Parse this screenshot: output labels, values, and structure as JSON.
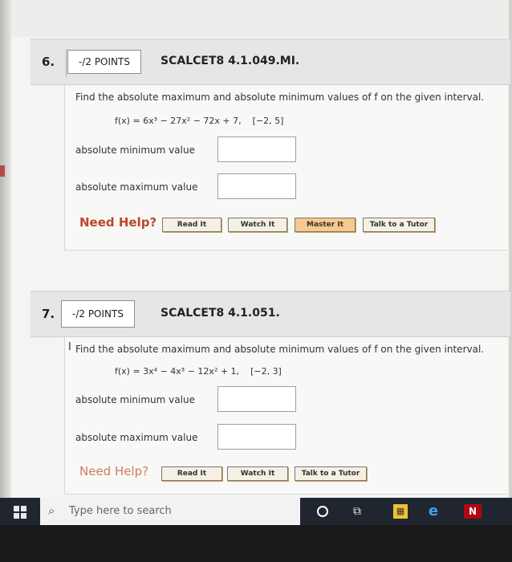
{
  "questions": [
    {
      "number": "6.",
      "points": "-/2 POINTS",
      "code": "SCALCET8 4.1.049.MI.",
      "prompt": "Find the absolute maximum and absolute minimum values of f on the given interval.",
      "function": "f(x) = 6x³ − 27x² − 72x + 7,",
      "interval": "[−2, 5]",
      "min_label": "absolute minimum value",
      "max_label": "absolute maximum value",
      "min_value": "",
      "max_value": "",
      "need_help": "Need Help?",
      "help_buttons": [
        "Read It",
        "Watch It",
        "Master It",
        "Talk to a Tutor"
      ]
    },
    {
      "number": "7.",
      "points": "-/2 POINTS",
      "code": "SCALCET8 4.1.051.",
      "prompt": "Find the absolute maximum and absolute minimum values of f on the given interval.",
      "function": "f(x) = 3x⁴ − 4x³ − 12x² + 1,",
      "interval": "[−2, 3]",
      "min_label": "absolute minimum value",
      "max_label": "absolute maximum value",
      "min_value": "",
      "max_value": "",
      "need_help": "Need Help?",
      "help_buttons": [
        "Read It",
        "Watch It",
        "Talk to a Tutor"
      ]
    }
  ],
  "taskbar": {
    "search_placeholder": "Type here to search"
  },
  "colors": {
    "help_text": "#c0452c",
    "taskbar": "#1f2630",
    "button_face": "#f6f0e4",
    "button_accent": "#f7c98c"
  },
  "icons": [
    "windows-start-icon",
    "search-icon",
    "cortana-icon",
    "task-view-icon",
    "store-icon",
    "edge-icon",
    "netflix-icon",
    "text-cursor-icon"
  ]
}
